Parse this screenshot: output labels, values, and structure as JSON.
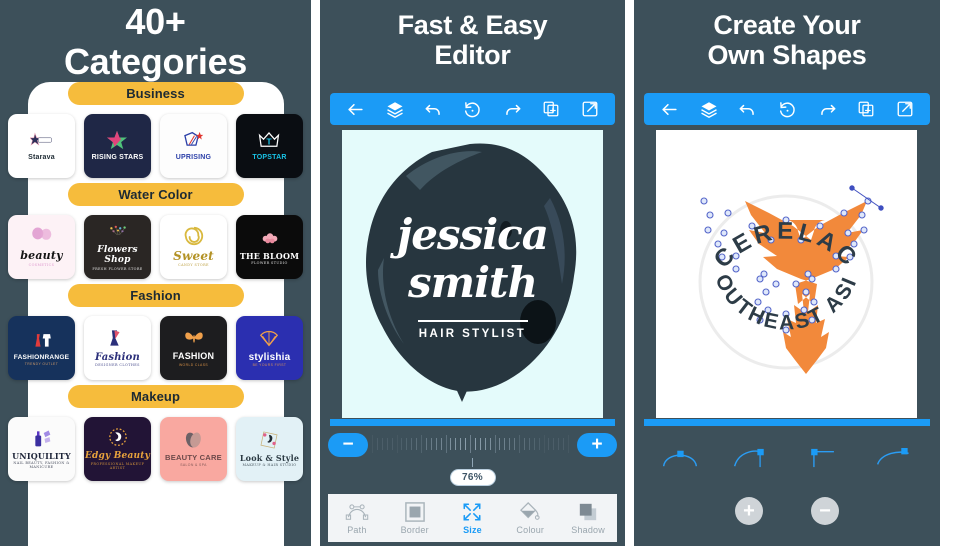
{
  "panels": [
    {
      "id": "categories",
      "headline": {
        "line1": "40+",
        "line2": "Categories"
      },
      "categories": [
        {
          "name": "Business",
          "logos": [
            {
              "name": "Starava",
              "sub": "",
              "bg": "#ffffff",
              "fg": "#1d2a33",
              "accent": "#2b2f58",
              "icon": "star"
            },
            {
              "name": "RISING STARS",
              "sub": "",
              "bg": "#1f2746",
              "fg": "#ffffff",
              "accent": "#e0447c",
              "icon": "star"
            },
            {
              "name": "UPRISING",
              "sub": "",
              "bg": "#fdfdfd",
              "fg": "#2b3fa8",
              "accent": "#e0342e",
              "icon": "shield"
            },
            {
              "name": "TOPSTAR",
              "sub": "",
              "bg": "#0a0d12",
              "fg": "#ffffff",
              "accent": "#19c3e6",
              "icon": "crown"
            }
          ]
        },
        {
          "name": "Water Color",
          "logos": [
            {
              "name": "beauty",
              "sub": "COSMETICS",
              "bg": "#fdf2f6",
              "fg": "#141414",
              "accent": "#d98bc8",
              "icon": "butterfly"
            },
            {
              "name": "Flowers Shop",
              "sub": "FRESH FLOWER STORE",
              "bg": "#2a2624",
              "fg": "#ffffff",
              "accent": "#f0c24a",
              "icon": "flowers"
            },
            {
              "name": "Sweet",
              "sub": "CANDY STORE",
              "bg": "#ffffff",
              "fg": "#b39225",
              "accent": "#d9b93f",
              "icon": "swirl"
            },
            {
              "name": "THE BLOOM",
              "sub": "FLOWER STUDIO",
              "bg": "#0b0b0b",
              "fg": "#ffffff",
              "accent": "#f3aab8",
              "icon": "blossom"
            }
          ]
        },
        {
          "name": "Fashion",
          "logos": [
            {
              "name": "FASHIONRANGE",
              "sub": "TRENDY OUTLET",
              "bg": "#16325c",
              "fg": "#ffffff",
              "accent": "#e23b3b",
              "icon": "dress"
            },
            {
              "name": "Fashion",
              "sub": "DESIGNER CLOTHES",
              "bg": "#ffffff",
              "fg": "#2b2f7a",
              "accent": "#e2556e",
              "icon": "dress"
            },
            {
              "name": "FASHION",
              "sub": "WORLD CLASS",
              "bg": "#1d1d1f",
              "fg": "#ffffff",
              "accent": "#f0a04b",
              "icon": "butterfly"
            },
            {
              "name": "stylishia",
              "sub": "BE YOURS FIRST",
              "bg": "#2b2fb0",
              "fg": "#ffffff",
              "accent": "#f0a04b",
              "icon": "fan"
            }
          ]
        },
        {
          "name": "Makeup",
          "logos": [
            {
              "name": "UNIQUILITY",
              "sub": "NAIL BEAUTY, FASHION & MANICURE",
              "bg": "#fbfbfb",
              "fg": "#1d2438",
              "accent": "#5b37c4",
              "icon": "polish"
            },
            {
              "name": "Edgy Beauty",
              "sub": "PROFESSIONAL MAKEUP ARTIST",
              "bg": "#221436",
              "fg": "#e8a33c",
              "accent": "#e8a33c",
              "icon": "face"
            },
            {
              "name": "BEAUTY CARE",
              "sub": "SALON & SPA",
              "bg": "#f9a8a0",
              "fg": "#6d4a4a",
              "accent": "#7d6a6e",
              "icon": "leaf"
            },
            {
              "name": "Look & Style",
              "sub": "MAKEUP & HAIR STUDIO",
              "bg": "#e2f1f6",
              "fg": "#2c3b44",
              "accent": "#e0608a",
              "icon": "lady"
            }
          ]
        }
      ]
    },
    {
      "id": "editor",
      "headline": {
        "line1": "Fast & Easy",
        "line2": "Editor"
      },
      "toolbar": {
        "items": [
          {
            "icon": "back-arrow-icon",
            "label": "Back"
          },
          {
            "icon": "layers-icon",
            "label": "Layers"
          },
          {
            "icon": "undo-icon",
            "label": "Undo"
          },
          {
            "icon": "reset-icon",
            "label": "Reset"
          },
          {
            "icon": "redo-icon",
            "label": "Redo"
          },
          {
            "icon": "duplicate-icon",
            "label": "Duplicate"
          },
          {
            "icon": "export-icon",
            "label": "Export"
          }
        ]
      },
      "canvas": {
        "background": "#e4fbfb",
        "blob_color": "#23333f",
        "line1": "jessica",
        "line2": "smith",
        "tagline": "HAIR STYLIST"
      },
      "slider": {
        "minus_label": "−",
        "plus_label": "+",
        "value_label": "76%",
        "value": 76
      },
      "tabs": [
        {
          "label": "Path",
          "icon": "path-node-icon",
          "active": false
        },
        {
          "label": "Border",
          "icon": "border-icon",
          "active": false
        },
        {
          "label": "Size",
          "icon": "resize-icon",
          "active": true
        },
        {
          "label": "Colour",
          "icon": "paint-bucket-icon",
          "active": false
        },
        {
          "label": "Shadow",
          "icon": "shadow-icon",
          "active": false
        }
      ]
    },
    {
      "id": "shapes",
      "headline": {
        "line1": "Create Your",
        "line2": "Own Shapes"
      },
      "toolbar": {
        "items": [
          {
            "icon": "back-arrow-icon",
            "label": "Back"
          },
          {
            "icon": "layers-icon",
            "label": "Layers"
          },
          {
            "icon": "undo-icon",
            "label": "Undo"
          },
          {
            "icon": "reset-icon",
            "label": "Reset"
          },
          {
            "icon": "redo-icon",
            "label": "Redo"
          },
          {
            "icon": "duplicate-icon",
            "label": "Duplicate"
          },
          {
            "icon": "export-icon",
            "label": "Export"
          }
        ]
      },
      "canvas": {
        "background": "#ffffff",
        "shape_color": "#f2893b",
        "text_color": "#2d3c47",
        "top_text": "CERELAC",
        "bottom_text": "SOUTHEAST ASIA"
      },
      "node_tools": [
        {
          "icon": "node-smooth-icon",
          "label": "Smooth node"
        },
        {
          "icon": "node-asymmetric-icon",
          "label": "Asymmetric node"
        },
        {
          "icon": "node-corner-icon",
          "label": "Corner node"
        },
        {
          "icon": "node-mirrored-icon",
          "label": "Mirrored node"
        }
      ],
      "point_buttons": [
        {
          "icon": "add-point-icon",
          "label": "+"
        },
        {
          "icon": "remove-point-icon",
          "label": "−"
        }
      ]
    }
  ],
  "colors": {
    "background": "#3d505a",
    "accent_blue": "#1b9bf6",
    "pill_yellow": "#f6bc3c",
    "white": "#ffffff"
  }
}
